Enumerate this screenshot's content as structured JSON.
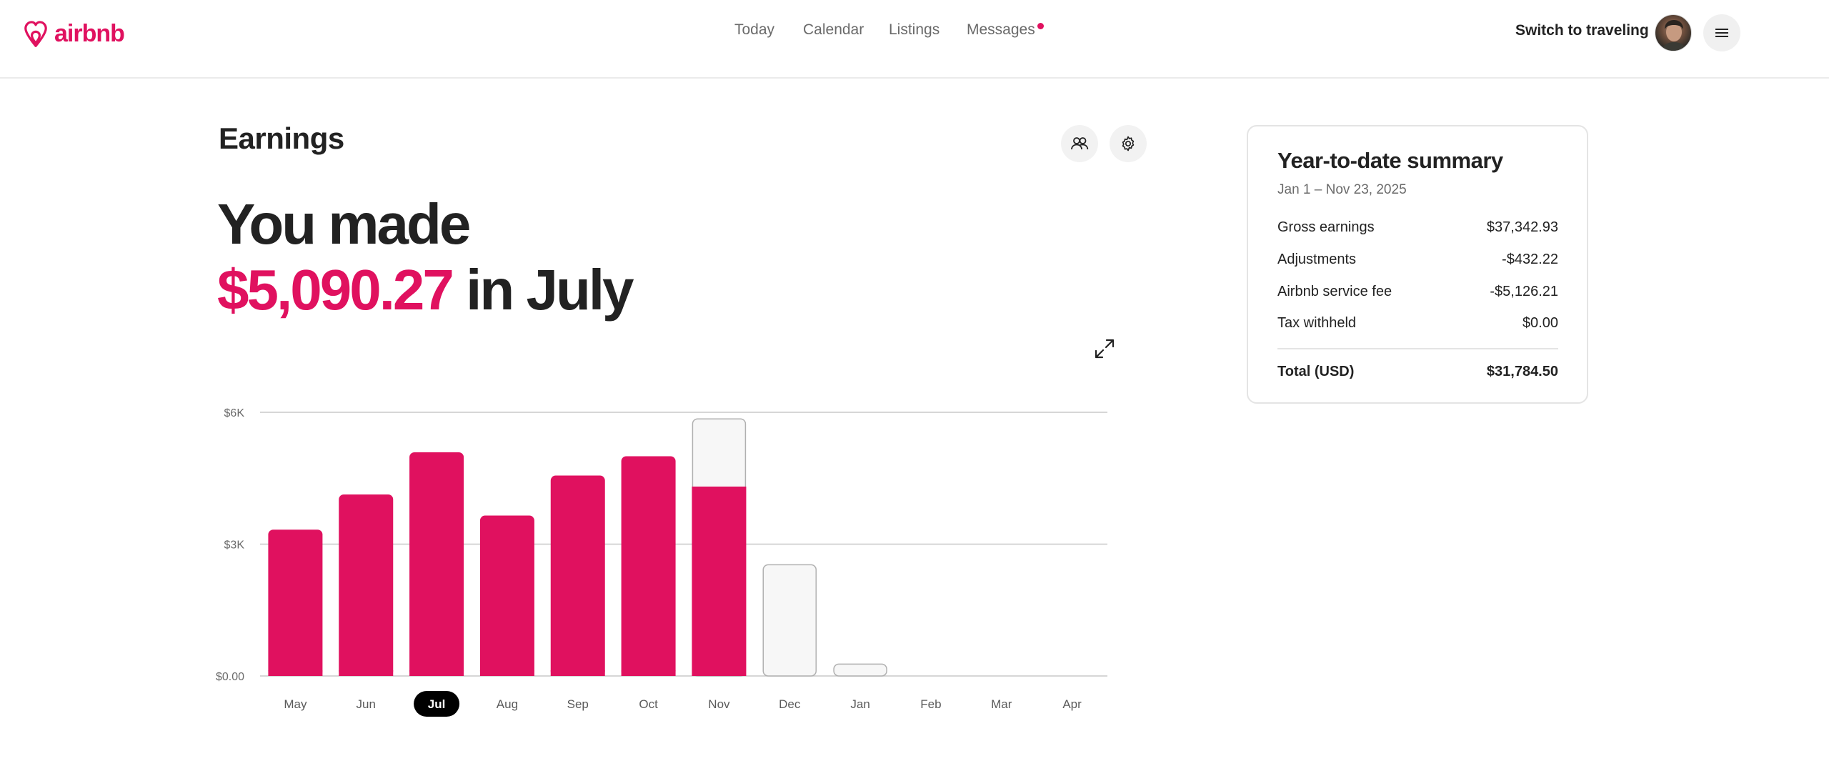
{
  "brand": {
    "name": "airbnb",
    "color": "#e0115f"
  },
  "nav": {
    "items": [
      {
        "label": "Today"
      },
      {
        "label": "Calendar"
      },
      {
        "label": "Listings"
      },
      {
        "label": "Messages",
        "has_notification": true
      }
    ]
  },
  "header": {
    "switch_label": "Switch to traveling"
  },
  "page": {
    "title": "Earnings",
    "hero_line1": "You made",
    "hero_amount": "$5,090.27",
    "hero_suffix": "in July"
  },
  "chart_data": {
    "type": "bar",
    "categories": [
      "May",
      "Jun",
      "Jul",
      "Aug",
      "Sep",
      "Oct",
      "Nov",
      "Dec",
      "Jan",
      "Feb",
      "Mar",
      "Apr"
    ],
    "series": [
      {
        "values": [
          3330,
          4130,
          5090,
          3650,
          4560,
          5000,
          4310,
          0,
          0,
          0,
          0,
          0
        ]
      },
      {
        "values": [
          0,
          0,
          0,
          0,
          0,
          0,
          1540,
          2530,
          270,
          0,
          0,
          0
        ]
      }
    ],
    "selected_category": "Jul",
    "y_ticks": [
      "$0.00",
      "$3K",
      "$6K"
    ],
    "y_tick_values": [
      0,
      3000,
      6000
    ],
    "ylim": [
      0,
      6000
    ],
    "grid": true,
    "colors": {
      "paid": "#e0115f",
      "upcoming_fill": "#f7f7f7",
      "upcoming_stroke": "#b0b0b0",
      "grid": "#c8c8c8"
    }
  },
  "summary": {
    "title": "Year-to-date summary",
    "date_range": "Jan 1 – Nov 23, 2025",
    "rows": [
      {
        "label": "Gross earnings",
        "value": "$37,342.93"
      },
      {
        "label": "Adjustments",
        "value": "-$432.22"
      },
      {
        "label": "Airbnb service fee",
        "value": "-$5,126.21"
      },
      {
        "label": "Tax withheld",
        "value": "$0.00"
      }
    ],
    "total": {
      "label": "Total (USD)",
      "value": "$31,784.50"
    }
  }
}
